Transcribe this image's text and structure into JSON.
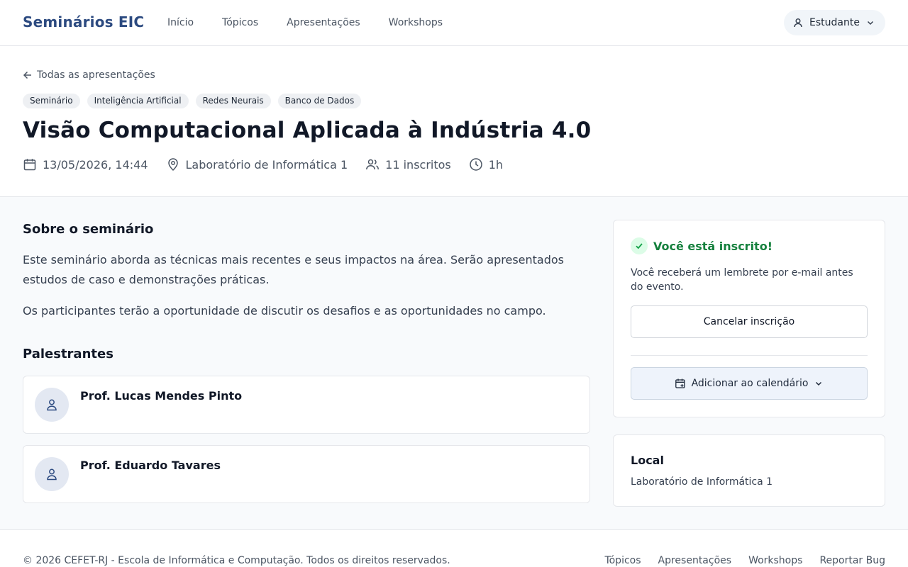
{
  "header": {
    "brand": "Seminários EIC",
    "nav": [
      "Início",
      "Tópicos",
      "Apresentações",
      "Workshops"
    ],
    "user_label": "Estudante"
  },
  "hero": {
    "back_label": "Todas as apresentações",
    "tags": [
      "Seminário",
      "Inteligência Artificial",
      "Redes Neurais",
      "Banco de Dados"
    ],
    "title": "Visão Computacional Aplicada à Indústria 4.0",
    "meta": {
      "datetime": "13/05/2026, 14:44",
      "location": "Laboratório de Informática 1",
      "attendees": "11 inscritos",
      "duration": "1h"
    }
  },
  "about": {
    "title": "Sobre o seminário",
    "paragraph1": "Este seminário aborda as técnicas mais recentes e seus impactos na área. Serão apresentados estudos de caso e demonstrações práticas.",
    "paragraph2": "Os participantes terão a oportunidade de discutir os desafios e as oportunidades no campo."
  },
  "speakers": {
    "title": "Palestrantes",
    "items": [
      {
        "name": "Prof. Lucas Mendes Pinto"
      },
      {
        "name": "Prof. Eduardo Tavares"
      }
    ]
  },
  "enrollment": {
    "status": "Você está inscrito!",
    "reminder": "Você receberá um lembrete por e-mail antes do evento.",
    "cancel_label": "Cancelar inscrição",
    "calendar_label": "Adicionar ao calendário"
  },
  "venue": {
    "title": "Local",
    "value": "Laboratório de Informática 1"
  },
  "footer": {
    "copyright": "© 2026 CEFET-RJ - Escola de Informática e Computação. Todos os direitos reservados.",
    "links": [
      "Tópicos",
      "Apresentações",
      "Workshops",
      "Reportar Bug"
    ]
  },
  "colors": {
    "brand": "#2c4a80",
    "success": "#15803d",
    "page_bg": "#f8fafc"
  },
  "icons": [
    "user-icon",
    "chevron-down-icon",
    "arrow-left-icon",
    "calendar-icon",
    "map-pin-icon",
    "users-icon",
    "clock-icon",
    "check-icon",
    "calendar-plus-icon"
  ]
}
